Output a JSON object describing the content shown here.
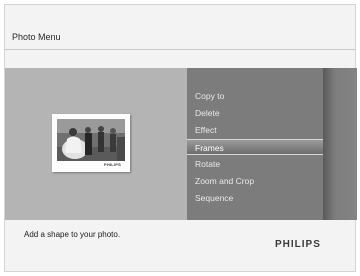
{
  "header": {
    "title": "Photo Menu"
  },
  "thumbnail": {
    "logo_text": "PHILIPS"
  },
  "menu": {
    "items": [
      {
        "label": "Copy to",
        "selected": false
      },
      {
        "label": "Delete",
        "selected": false
      },
      {
        "label": "Effect",
        "selected": false
      },
      {
        "label": "Frames",
        "selected": true
      },
      {
        "label": "Rotate",
        "selected": false
      },
      {
        "label": "Zoom and Crop",
        "selected": false
      },
      {
        "label": "Sequence",
        "selected": false
      }
    ]
  },
  "footer": {
    "help_text": "Add a shape to your photo.",
    "brand": "PHILIPS"
  }
}
